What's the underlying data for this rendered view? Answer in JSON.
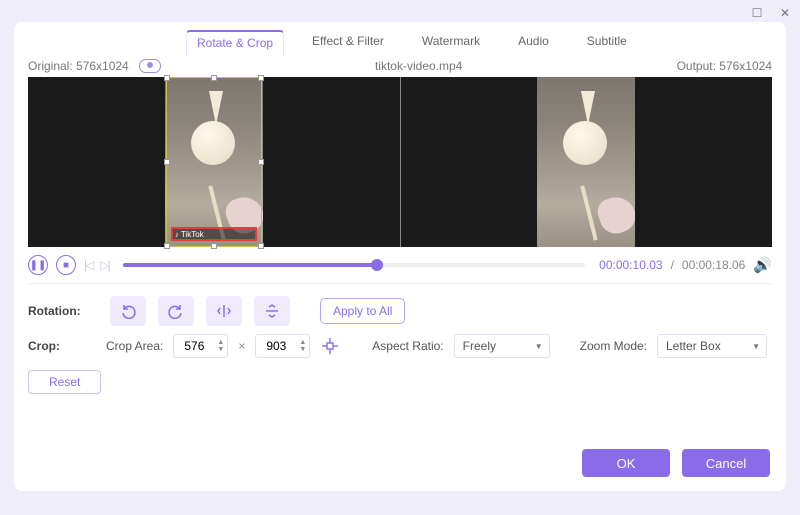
{
  "titlebar": {
    "min": "—",
    "max": "☐",
    "close": "✕"
  },
  "tabs": {
    "items": [
      {
        "label": "Rotate & Crop",
        "active": true
      },
      {
        "label": "Effect & Filter"
      },
      {
        "label": "Watermark"
      },
      {
        "label": "Audio"
      },
      {
        "label": "Subtitle"
      }
    ]
  },
  "info": {
    "original_label": "Original: 576x1024",
    "filename": "tiktok-video.mp4",
    "output_label": "Output: 576x1024"
  },
  "transport": {
    "time_current": "00:00:10.03",
    "separator": "/",
    "time_total": "00:00:18.06"
  },
  "rotation": {
    "label": "Rotation:",
    "apply_all": "Apply to All"
  },
  "crop": {
    "label": "Crop:",
    "area_label": "Crop Area:",
    "w": "576",
    "h": "903",
    "aspect_label": "Aspect Ratio:",
    "aspect_value": "Freely",
    "zoom_label": "Zoom Mode:",
    "zoom_value": "Letter Box",
    "reset": "Reset"
  },
  "footer": {
    "ok": "OK",
    "cancel": "Cancel"
  }
}
